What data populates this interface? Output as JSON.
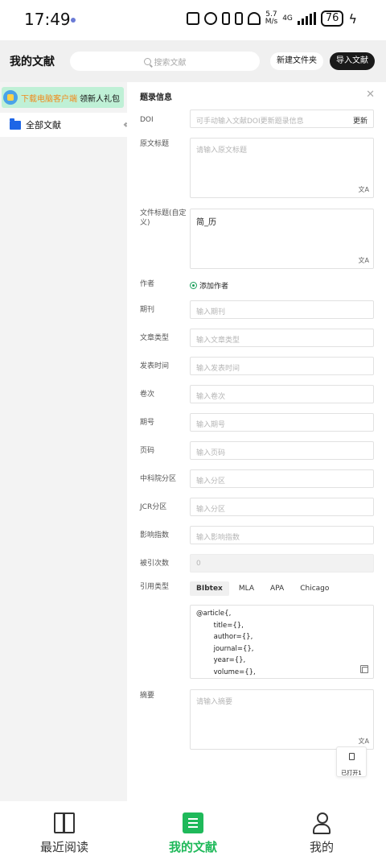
{
  "status_bar": {
    "time": "17:49",
    "net_speed_top": "5.7",
    "net_speed_bottom": "M/s",
    "network": "4G",
    "battery": "76"
  },
  "header": {
    "title": "我的文献",
    "search_placeholder": "搜索文献",
    "new_folder_label": "新建文件夹",
    "import_label": "导入文献"
  },
  "sidebar": {
    "banner_highlight": "下载电脑客户端",
    "banner_rest": "领新人礼包",
    "folder_label": "全部文献"
  },
  "panel": {
    "title": "题录信息",
    "doi": {
      "label": "DOI",
      "placeholder": "可手动输入文献DOI更新题录信息",
      "action": "更新"
    },
    "original_title": {
      "label": "原文标题",
      "placeholder": "请输入原文标题"
    },
    "file_title": {
      "label": "文件标题(自定义)",
      "value": "简_历"
    },
    "author": {
      "label": "作者",
      "add_label": "添加作者"
    },
    "journal": {
      "label": "期刊",
      "placeholder": "输入期刊"
    },
    "article_type": {
      "label": "文章类型",
      "placeholder": "输入文章类型"
    },
    "publish_date": {
      "label": "发表时间",
      "placeholder": "输入发表时间"
    },
    "volume": {
      "label": "卷次",
      "placeholder": "输入卷次"
    },
    "issue": {
      "label": "期号",
      "placeholder": "输入期号"
    },
    "pages": {
      "label": "页码",
      "placeholder": "输入页码"
    },
    "cas_zone": {
      "label": "中科院分区",
      "placeholder": "输入分区"
    },
    "jcr_zone": {
      "label": "JCR分区",
      "placeholder": "输入分区"
    },
    "impact_factor": {
      "label": "影响指数",
      "placeholder": "输入影响指数"
    },
    "citations": {
      "label": "被引次数",
      "value": "0"
    },
    "citation_type": {
      "label": "引用类型",
      "tabs": [
        "BIbtex",
        "MLA",
        "APA",
        "Chicago"
      ],
      "active_tab": "BIbtex",
      "content": "@article{,\n        title={},\n        author={},\n        journal={},\n        year={},\n        volume={},\n        pages={}"
    },
    "abstract": {
      "label": "摘要",
      "placeholder": "请输入摘要"
    },
    "translate_glyph": "文A",
    "opened_label": "已打开1"
  },
  "bottom_nav": {
    "items": [
      {
        "label": "最近阅读",
        "icon": "book-icon"
      },
      {
        "label": "我的文献",
        "icon": "list-icon",
        "active": true
      },
      {
        "label": "我的",
        "icon": "user-icon"
      }
    ],
    "active_color": "#1fb95a"
  }
}
